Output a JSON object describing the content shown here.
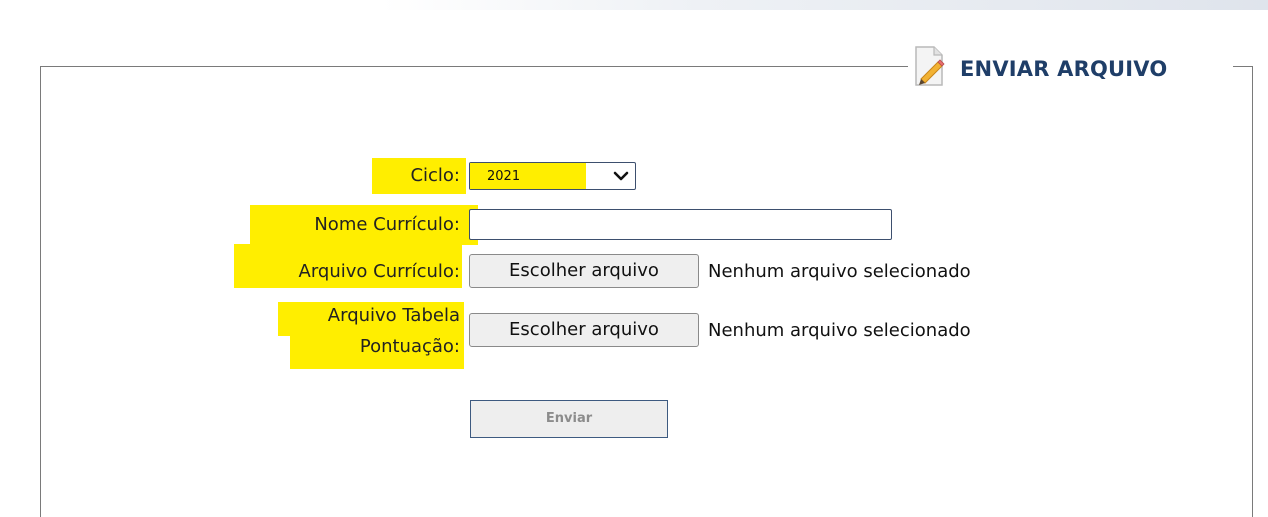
{
  "section": {
    "title": "ENVIAR ARQUIVO"
  },
  "form": {
    "ciclo_label": "Ciclo:",
    "ciclo_value": "2021",
    "nome_label": "Nome Currículo:",
    "nome_value": "",
    "arquivo_curriculo_label": "Arquivo Currículo:",
    "arquivo_tabela_label_line1": "Arquivo Tabela",
    "arquivo_tabela_label_line2": "Pontuação:",
    "file_button_label": "Escolher arquivo",
    "file_status": "Nenhum arquivo selecionado",
    "submit_label": "Enviar"
  },
  "colors": {
    "highlight": "#ffee00",
    "title": "#1f3e68",
    "border": "#3d4f6e"
  },
  "icons": {
    "legend_icon": "edit-document-icon",
    "select_icon": "chevron-down-icon"
  }
}
